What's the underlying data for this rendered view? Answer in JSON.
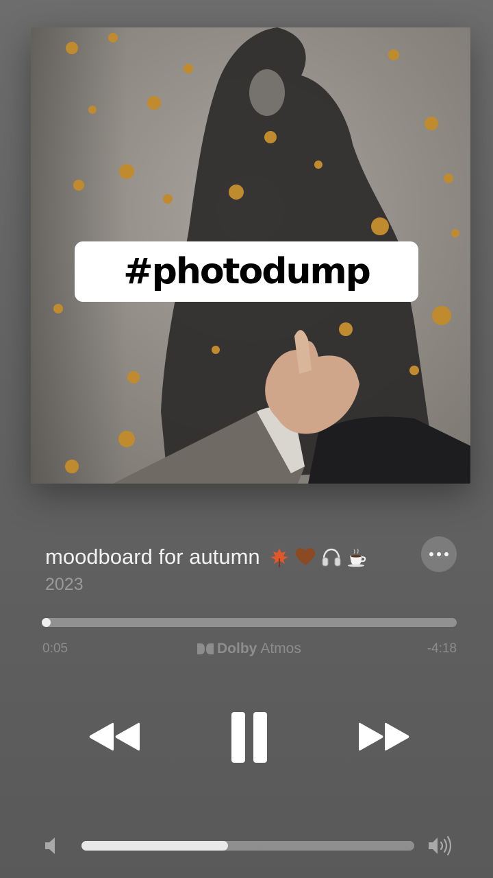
{
  "artwork": {
    "overlay_text": "#photodump"
  },
  "track": {
    "title": "moodboard for autumn",
    "title_emojis": [
      "maple-leaf",
      "brown-heart",
      "headphones",
      "hot-beverage"
    ],
    "subtitle": "2023"
  },
  "playback": {
    "elapsed": "0:05",
    "remaining": "-4:18",
    "progress_fraction": 0.02,
    "audio_badge": {
      "brand": "Dolby",
      "format": "Atmos"
    }
  },
  "volume": {
    "level_fraction": 0.44
  },
  "colors": {
    "background": "#626262",
    "primary_text": "#f2f2f2",
    "secondary_text": "#9a9a9a",
    "control_icons": "#ffffff"
  }
}
